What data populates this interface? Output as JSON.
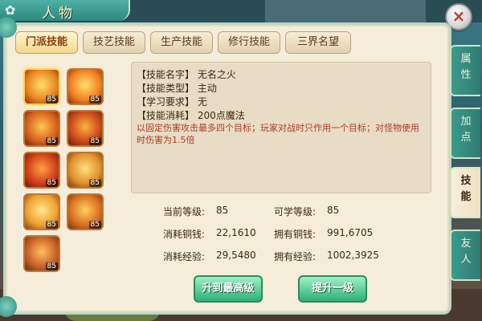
{
  "window": {
    "title": "人物",
    "close_label": "×"
  },
  "tabs": [
    {
      "label": "门派技能",
      "active": true
    },
    {
      "label": "技艺技能",
      "active": false
    },
    {
      "label": "生产技能",
      "active": false
    },
    {
      "label": "修行技能",
      "active": false
    },
    {
      "label": "三界名望",
      "active": false
    }
  ],
  "side_tabs": [
    {
      "label": "属性",
      "active": false
    },
    {
      "label": "加点",
      "active": false
    },
    {
      "label": "技能",
      "active": true
    },
    {
      "label": "友人",
      "active": false
    }
  ],
  "skills": [
    {
      "level": "85",
      "icon": "fire-swirl-skill-icon",
      "color": "#e8841f",
      "selected": true
    },
    {
      "level": "85",
      "icon": "fire-burst-skill-icon",
      "color": "#f08020",
      "selected": false
    },
    {
      "level": "85",
      "icon": "fire-figure-skill-icon",
      "color": "#d9601c",
      "selected": false
    },
    {
      "level": "85",
      "icon": "fire-horn-skill-icon",
      "color": "#c9481a",
      "selected": false
    },
    {
      "level": "85",
      "icon": "fire-demon-skill-icon",
      "color": "#cf3e1a",
      "selected": false
    },
    {
      "level": "85",
      "icon": "fire-monkey-skill-icon",
      "color": "#e0902a",
      "selected": false
    },
    {
      "level": "85",
      "icon": "fire-shadow-skill-icon",
      "color": "#f0a030",
      "selected": false
    },
    {
      "level": "85",
      "icon": "fire-chain-skill-icon",
      "color": "#d97020",
      "selected": false
    },
    {
      "level": "85",
      "icon": "fire-bull-skill-icon",
      "color": "#c86028",
      "selected": false
    }
  ],
  "detail": {
    "name_line": "【技能名字】 无名之火",
    "type_line": "【技能类型】 主动",
    "req_line": "【学习要求】 无",
    "cost_line": "【技能消耗】 200点魔法",
    "description": "以固定伤害攻击最多四个目标；玩家对战时只作用一个目标；对怪物使用时伤害为1.5倍"
  },
  "stats": {
    "current_level_label": "当前等级:",
    "current_level": "85",
    "learnable_level_label": "可学等级:",
    "learnable_level": "85",
    "cost_money_label": "消耗铜钱:",
    "cost_money": "22,1610",
    "own_money_label": "拥有铜钱:",
    "own_money": "991,6705",
    "cost_exp_label": "消耗经验:",
    "cost_exp": "29,5480",
    "own_exp_label": "拥有经验:",
    "own_exp": "1002,3925"
  },
  "buttons": {
    "max_level": "升到最高级",
    "up_one": "提升一级"
  }
}
